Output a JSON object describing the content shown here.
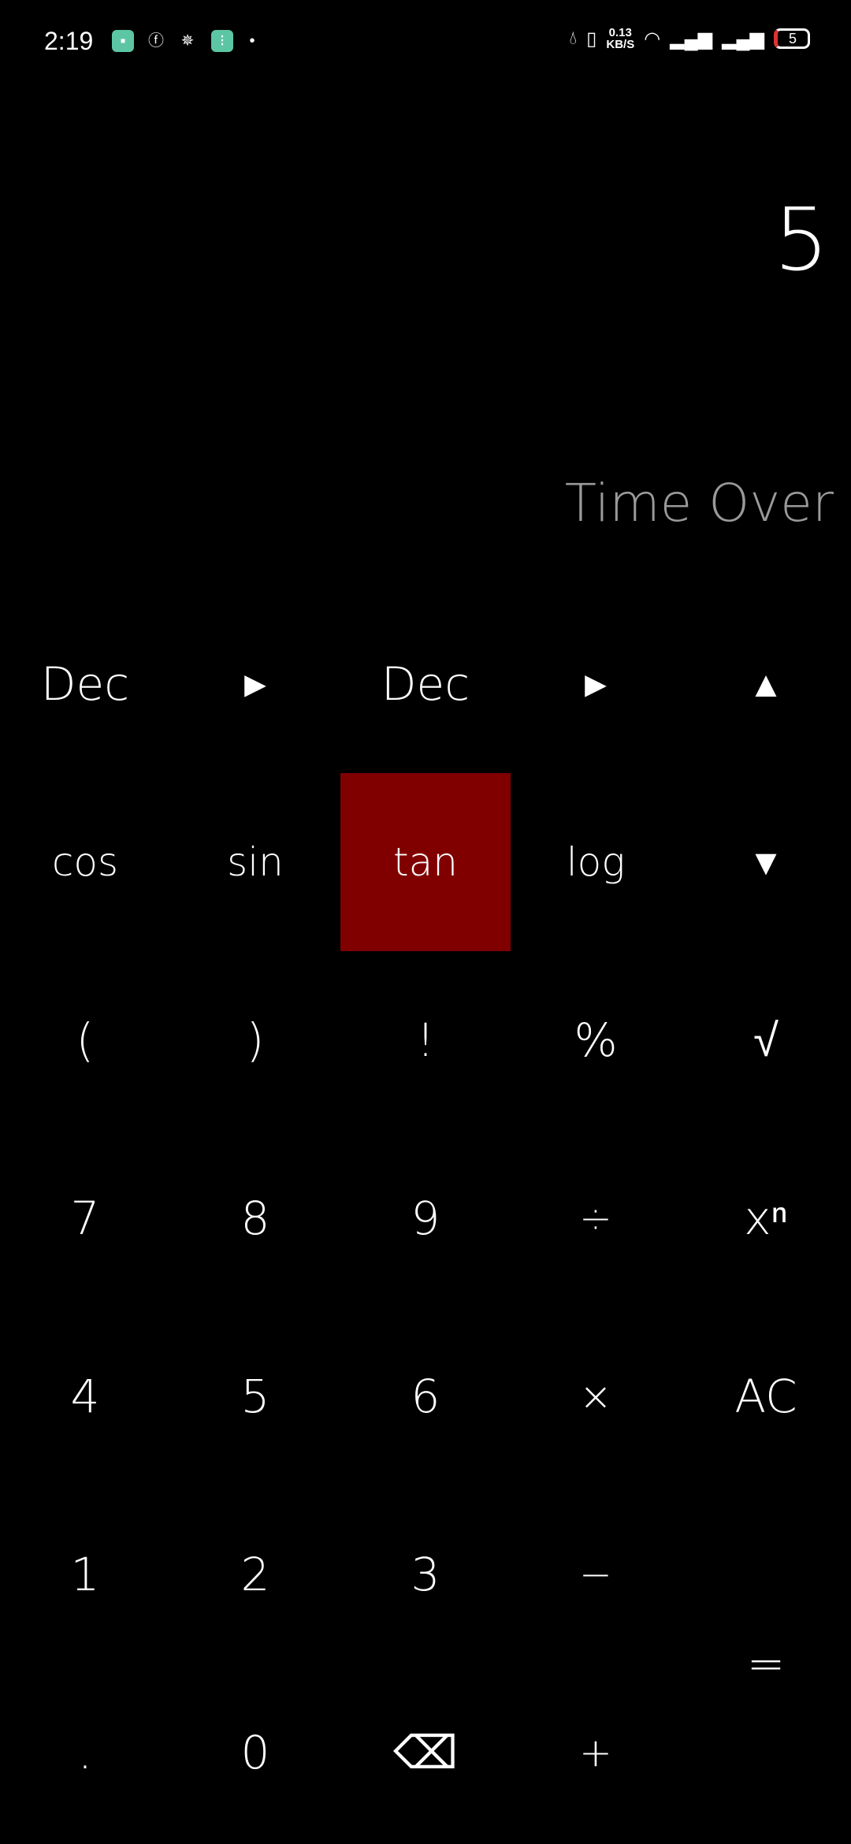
{
  "status_bar": {
    "time": "2:19",
    "speed_value": "0.13",
    "speed_unit": "KB/S",
    "battery": "5",
    "notification_icons": [
      "app-icon",
      "facebook-icon",
      "settings-hex-icon",
      "app2-icon",
      "dot-icon"
    ]
  },
  "display": {
    "value": "5",
    "message": "Time Over"
  },
  "accent": "#800000",
  "keys": [
    {
      "label": "Dec",
      "name": "mode-dec-left"
    },
    {
      "label": "►",
      "name": "arrow-right-1"
    },
    {
      "label": "Dec",
      "name": "mode-dec-right"
    },
    {
      "label": "►",
      "name": "arrow-right-2"
    },
    {
      "label": "▲",
      "name": "up"
    },
    {
      "label": "cos",
      "name": "cos"
    },
    {
      "label": "sin",
      "name": "sin"
    },
    {
      "label": "tan",
      "name": "tan"
    },
    {
      "label": "log",
      "name": "log"
    },
    {
      "label": "▼",
      "name": "down"
    },
    {
      "label": "(",
      "name": "open-paren"
    },
    {
      "label": ")",
      "name": "close-paren"
    },
    {
      "label": "!",
      "name": "factorial"
    },
    {
      "label": "%",
      "name": "percent"
    },
    {
      "label": "√",
      "name": "sqrt"
    },
    {
      "label": "7",
      "name": "7"
    },
    {
      "label": "8",
      "name": "8"
    },
    {
      "label": "9",
      "name": "9"
    },
    {
      "label": "÷",
      "name": "divide"
    },
    {
      "label": "xⁿ",
      "name": "power"
    },
    {
      "label": "4",
      "name": "4"
    },
    {
      "label": "5",
      "name": "5"
    },
    {
      "label": "6",
      "name": "6"
    },
    {
      "label": "×",
      "name": "multiply"
    },
    {
      "label": "AC",
      "name": "all-clear"
    },
    {
      "label": "1",
      "name": "1"
    },
    {
      "label": "2",
      "name": "2"
    },
    {
      "label": "3",
      "name": "3"
    },
    {
      "label": "−",
      "name": "minus"
    },
    {
      "label": "=",
      "name": "equals"
    },
    {
      "label": ".",
      "name": "decimal"
    },
    {
      "label": "0",
      "name": "0"
    },
    {
      "label": "⌫",
      "name": "backspace"
    },
    {
      "label": "+",
      "name": "plus"
    }
  ]
}
